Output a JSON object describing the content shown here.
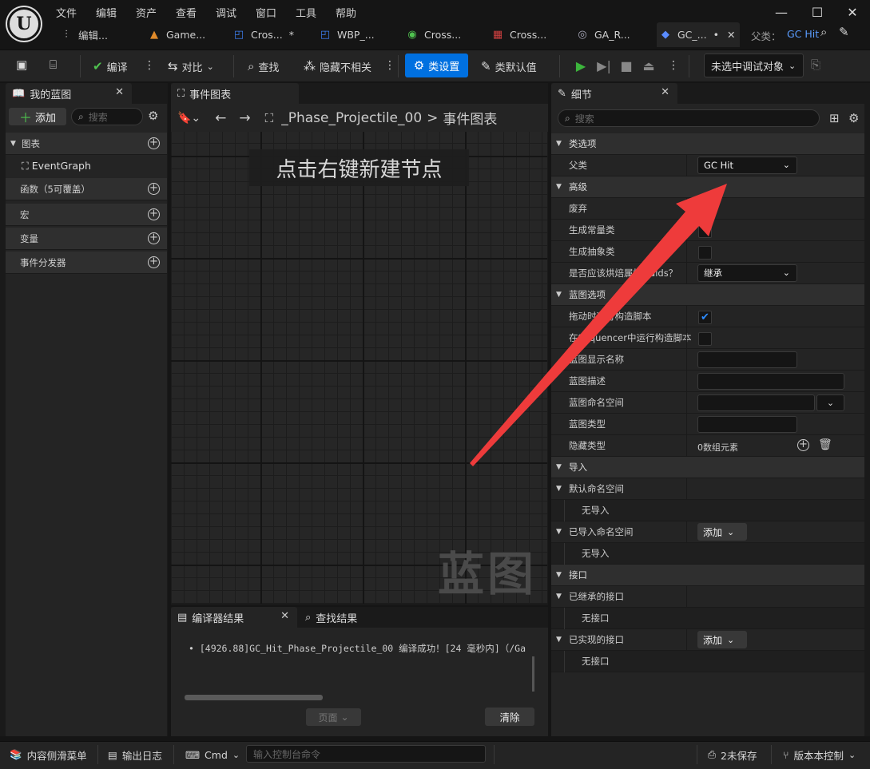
{
  "menu": [
    "文件",
    "编辑",
    "资产",
    "查看",
    "调试",
    "窗口",
    "工具",
    "帮助"
  ],
  "tabs": [
    {
      "label": "编辑...",
      "icon": "sliders-icon"
    },
    {
      "label": "Game...",
      "icon": "landscape-icon"
    },
    {
      "label": "Cros...",
      "icon": "widget-icon",
      "dirty": "*"
    },
    {
      "label": "WBP_...",
      "icon": "widget-icon"
    },
    {
      "label": "Cross...",
      "icon": "material-icon"
    },
    {
      "label": "Cross...",
      "icon": "texture-icon"
    },
    {
      "label": "GA_R...",
      "icon": "ability-icon"
    },
    {
      "label": "GC_...",
      "icon": "blueprint-icon",
      "dirty": "•"
    }
  ],
  "parent": {
    "label": "父类：",
    "value": "GC Hit"
  },
  "toolbar": {
    "compile": "编译",
    "diff": "对比",
    "find": "查找",
    "hide_unrelated": "隐藏不相关",
    "class_settings": "类设置",
    "class_defaults": "类默认值",
    "debug_target": "未选中调试对象"
  },
  "my_blueprint": {
    "title": "我的蓝图",
    "add": "添加",
    "search_placeholder": "搜索",
    "graphs": "图表",
    "event_graph": "EventGraph",
    "functions": "函数（5可覆盖）",
    "macros": "宏",
    "variables": "变量",
    "dispatchers": "事件分发器"
  },
  "event_graph": {
    "tab": "事件图表",
    "crumb_asset": "_Phase_Projectile_00",
    "crumb_graph": "事件图表",
    "hint": "点击右键新建节点",
    "watermark": "蓝图"
  },
  "compiler": {
    "tab": "编译器结果",
    "find_tab": "查找结果",
    "message": "[4926.88]GC_Hit_Phase_Projectile_00 编译成功！[24 毫秒内]（/Ga",
    "page": "页面",
    "clear": "清除"
  },
  "details": {
    "title": "细节",
    "search_placeholder": "搜索",
    "class_options": "类选项",
    "parent_class_label": "父类",
    "parent_class_value": "GC Hit",
    "advanced": "高级",
    "deprecate": "废弃",
    "generate_const": "生成常量类",
    "generate_abstract": "生成抽象类",
    "bake_label": "是否应该烘焙属性Guids？",
    "bake_value": "继承",
    "bp_options": "蓝图选项",
    "run_construction": "拖动时运行构造脚本",
    "run_sequencer": "在Sequencer中运行构造脚本",
    "display_name": "蓝图显示名称",
    "description": "蓝图描述",
    "namespace": "蓝图命名空间",
    "bp_type": "蓝图类型",
    "hide_categories": "隐藏类型",
    "hide_categories_value": "0数组元素",
    "imports": "导入",
    "default_namespace": "默认命名空间",
    "no_imports": "无导入",
    "imported_namespace": "已导入命名空间",
    "add": "添加",
    "interfaces": "接口",
    "inherited_interfaces": "已继承的接口",
    "no_interfaces": "无接口",
    "implemented_interfaces": "已实现的接口"
  },
  "statusbar": {
    "content_drawer": "内容侧滑菜单",
    "output_log": "输出日志",
    "cmd": "Cmd",
    "console_placeholder": "输入控制台命令",
    "unsaved": "2未保存",
    "source_control": "版本本控制"
  },
  "colors": {
    "accent": "#0070e0",
    "arrow": "#ee3b3b",
    "play": "#3cb53c",
    "check": "#2d8cff"
  }
}
